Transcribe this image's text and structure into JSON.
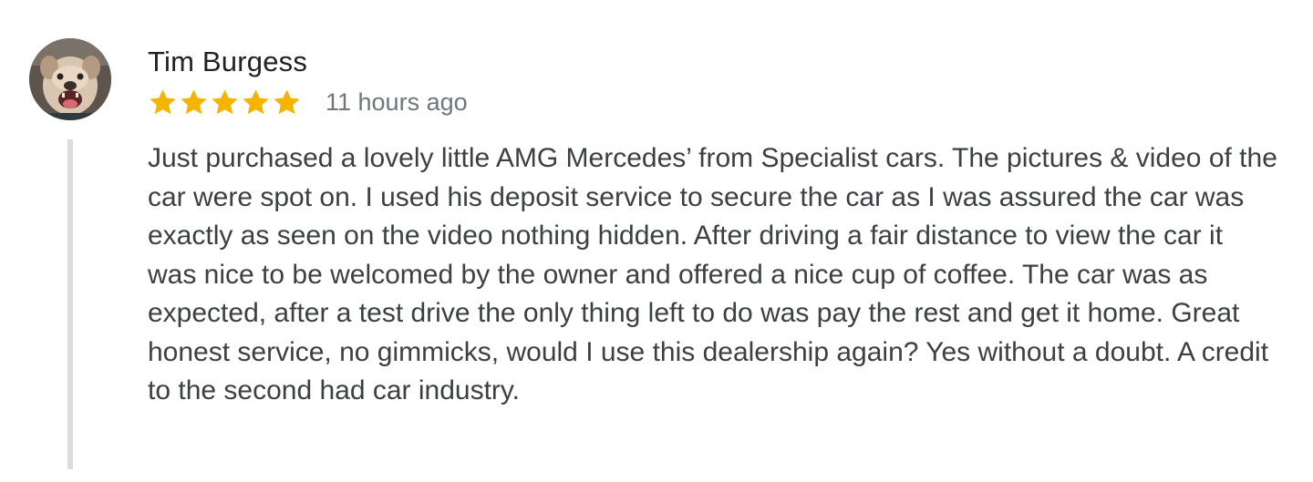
{
  "review": {
    "author": "Tim Burgess",
    "rating": 5,
    "rating_max": 5,
    "timestamp": "11 hours ago",
    "star_color": "#f4b400",
    "text": "Just purchased a lovely little AMG Mercedes’ from Specialist cars. The pictures & video of the car were spot on. I used his deposit service to secure the car as I was assured the car was exactly as seen on the video nothing hidden. After driving a fair distance to view the car it was nice to be welcomed by the owner and offered a nice cup of coffee. The car was as expected, after a test drive the only thing left to do was pay the rest and get it home. Great honest service, no gimmicks, would I use this dealership again? Yes without a doubt. A credit to the second had car industry."
  },
  "icons": {
    "avatar": "bulldog-profile-photo",
    "star": "star-icon"
  }
}
